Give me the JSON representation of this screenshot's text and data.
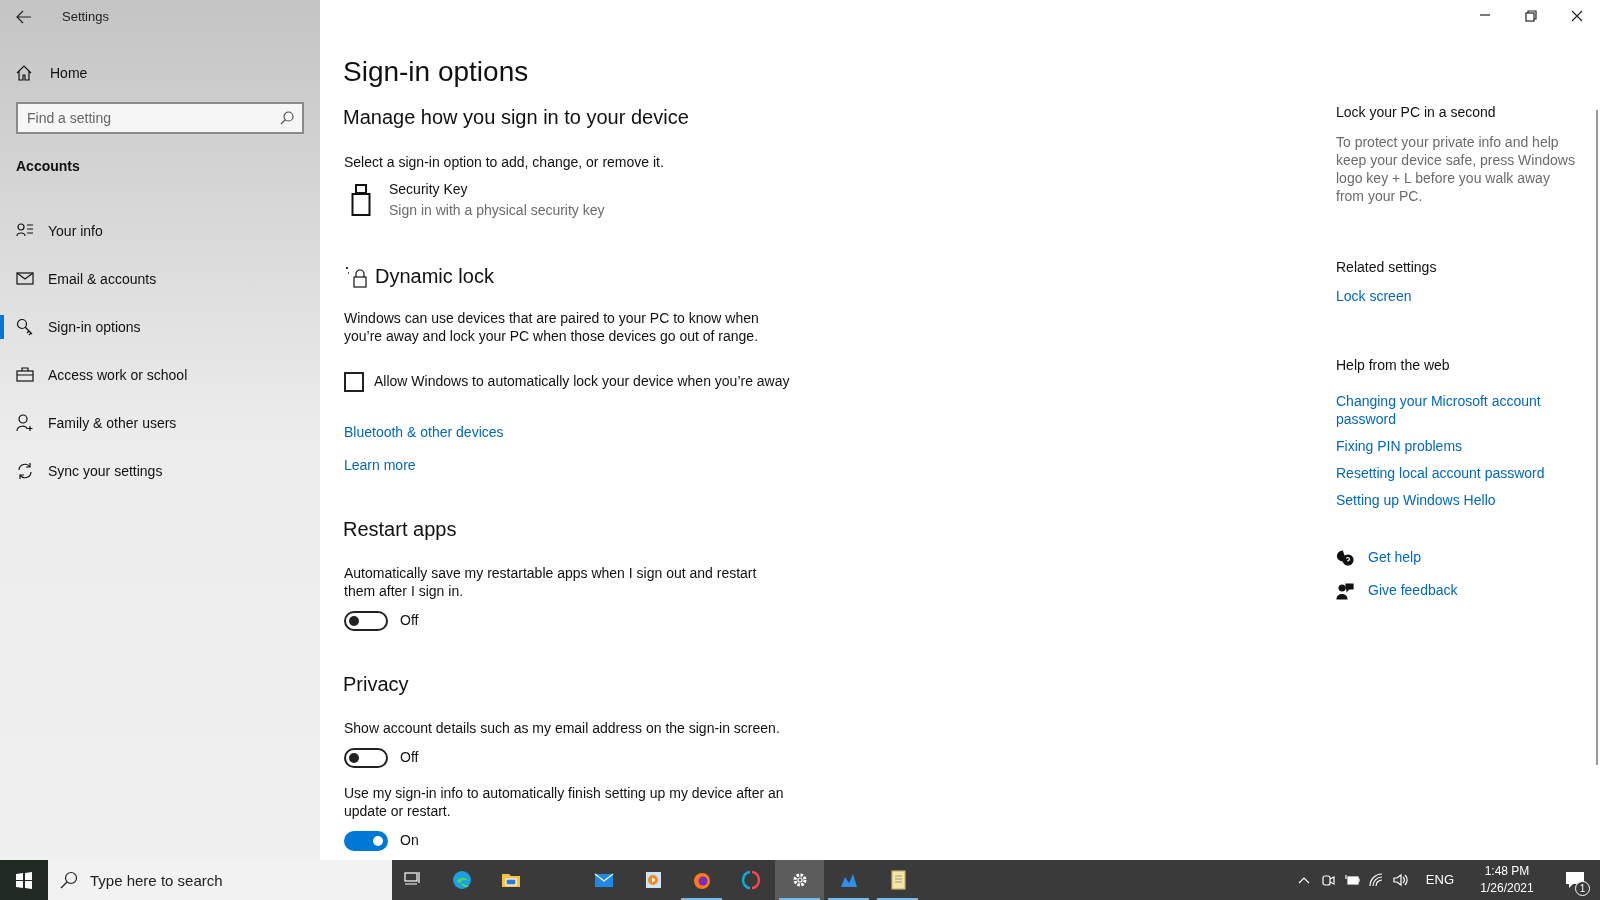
{
  "window": {
    "title": "Settings"
  },
  "sidebar": {
    "home": "Home",
    "search": {
      "placeholder": "Find a setting"
    },
    "section": "Accounts",
    "items": [
      {
        "label": "Your info",
        "selected": false
      },
      {
        "label": "Email & accounts",
        "selected": false
      },
      {
        "label": "Sign-in options",
        "selected": true
      },
      {
        "label": "Access work or school",
        "selected": false
      },
      {
        "label": "Family & other users",
        "selected": false
      },
      {
        "label": "Sync your settings",
        "selected": false
      }
    ]
  },
  "page": {
    "title": "Sign-in options",
    "subtitle": "Manage how you sign in to your device",
    "intro": "Select a sign-in option to add, change, or remove it.",
    "option": {
      "title": "Security Key",
      "description": "Sign in with a physical security key"
    },
    "dynamic_lock": {
      "heading": "Dynamic lock",
      "description": "Windows can use devices that are paired to your PC to know when you’re away and lock your PC when those devices go out of range.",
      "checkbox": {
        "label": "Allow Windows to automatically lock your device when you’re away",
        "checked": false
      },
      "links": [
        "Bluetooth & other devices",
        "Learn more"
      ]
    },
    "sections": [
      {
        "heading": "Restart apps",
        "toggles": [
          {
            "description": "Automatically save my restartable apps when I sign out and restart them after I sign in.",
            "on": false,
            "state": "Off"
          }
        ]
      },
      {
        "heading": "Privacy",
        "toggles": [
          {
            "description": "Show account details such as my email address on the sign-in screen.",
            "on": false,
            "state": "Off"
          },
          {
            "description": "Use my sign-in info to automatically finish setting up my device after an update or restart.",
            "on": true,
            "state": "On"
          }
        ]
      }
    ]
  },
  "aside": {
    "lock_heading": "Lock your PC in a second",
    "lock_text": "To protect your private info and help keep your device safe, press Windows logo key + L before you walk away from your PC.",
    "related_heading": "Related settings",
    "related_links": [
      "Lock screen"
    ],
    "web_heading": "Help from the web",
    "web_links": [
      "Changing your Microsoft account password",
      "Fixing PIN problems",
      "Resetting local account password",
      "Setting up Windows Hello"
    ],
    "help_links": [
      "Get help",
      "Give feedback"
    ]
  },
  "taskbar": {
    "search": {
      "placeholder": "Type here to search"
    },
    "apps": [
      {
        "running": false,
        "active": false
      },
      {
        "running": false,
        "active": false
      },
      {
        "running": false,
        "active": false
      },
      {
        "running": false,
        "active": false
      },
      {
        "running": false,
        "active": false
      },
      {
        "running": true,
        "active": false
      },
      {
        "running": false,
        "active": false
      },
      {
        "running": true,
        "active": true
      },
      {
        "running": true,
        "active": false
      },
      {
        "running": true,
        "active": false
      }
    ],
    "language": "ENG",
    "time": "1:48 PM",
    "date": "1/26/2021",
    "notifications": "1"
  }
}
